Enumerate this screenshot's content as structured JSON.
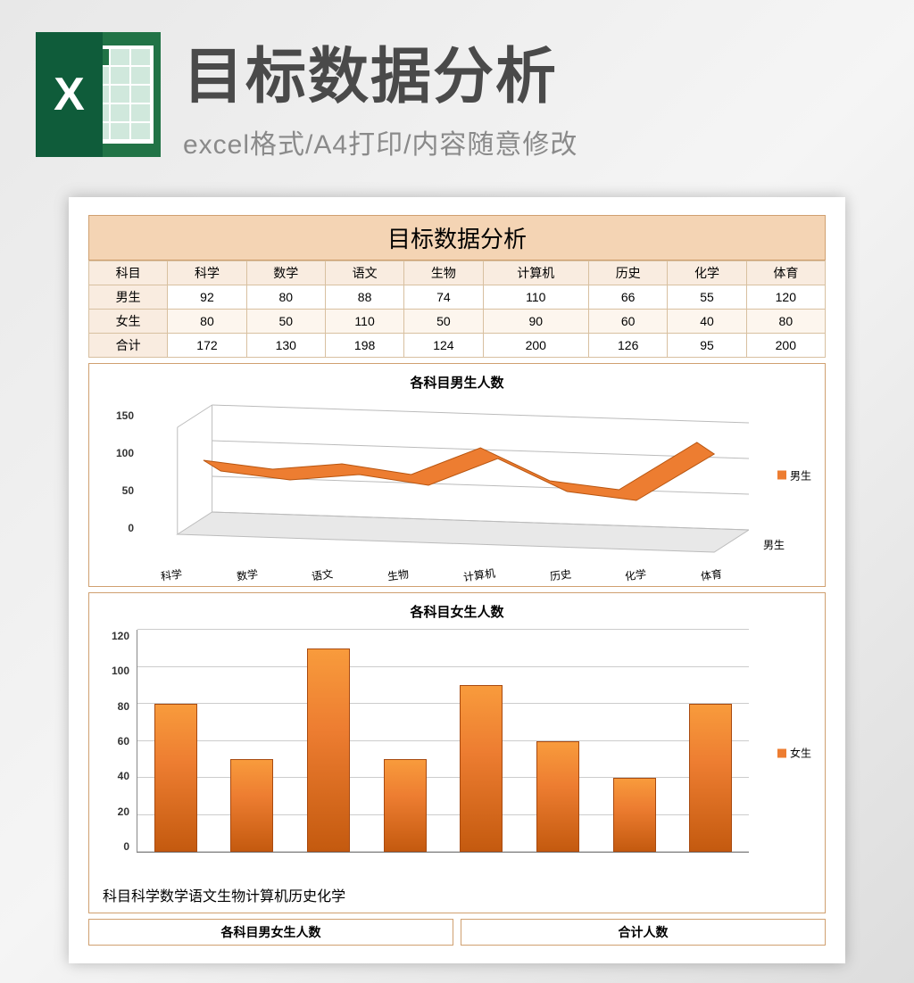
{
  "header": {
    "title": "目标数据分析",
    "subtitle": "excel格式/A4打印/内容随意修改",
    "icon_letter": "X"
  },
  "sheet_title": "目标数据分析",
  "table": {
    "row_header": "科目",
    "columns": [
      "科学",
      "数学",
      "语文",
      "生物",
      "计算机",
      "历史",
      "化学",
      "体育"
    ],
    "rows": [
      {
        "label": "男生",
        "values": [
          92,
          80,
          88,
          74,
          110,
          66,
          55,
          120
        ]
      },
      {
        "label": "女生",
        "values": [
          80,
          50,
          110,
          50,
          90,
          60,
          40,
          80
        ]
      },
      {
        "label": "合计",
        "values": [
          172,
          130,
          198,
          124,
          200,
          126,
          95,
          200
        ]
      }
    ]
  },
  "chart1": {
    "title": "各科目男生人数",
    "legend": "男生",
    "depth_label": "男生",
    "yticks": [
      "150",
      "100",
      "50",
      "0"
    ]
  },
  "chart2": {
    "title": "各科目女生人数",
    "legend": "女生",
    "yticks": [
      "120",
      "100",
      "80",
      "60",
      "40",
      "20",
      "0"
    ],
    "ymax": 120,
    "categories": [
      "科目",
      "科学",
      "数学",
      "语文",
      "生物",
      "计算机",
      "历史",
      "化学"
    ],
    "values": [
      80,
      50,
      110,
      50,
      90,
      60,
      40,
      80
    ]
  },
  "bottom": {
    "left": "各科目男女生人数",
    "right": "合计人数"
  },
  "chart_data": [
    {
      "type": "line",
      "title": "各科目男生人数",
      "categories": [
        "科学",
        "数学",
        "语文",
        "生物",
        "计算机",
        "历史",
        "化学",
        "体育"
      ],
      "series": [
        {
          "name": "男生",
          "values": [
            92,
            80,
            88,
            74,
            110,
            66,
            55,
            120
          ]
        }
      ],
      "ylim": [
        0,
        150
      ]
    },
    {
      "type": "bar",
      "title": "各科目女生人数",
      "categories": [
        "科学",
        "数学",
        "语文",
        "生物",
        "计算机",
        "历史",
        "化学",
        "体育"
      ],
      "series": [
        {
          "name": "女生",
          "values": [
            80,
            50,
            110,
            50,
            90,
            60,
            40,
            80
          ]
        }
      ],
      "ylim": [
        0,
        120
      ]
    }
  ]
}
